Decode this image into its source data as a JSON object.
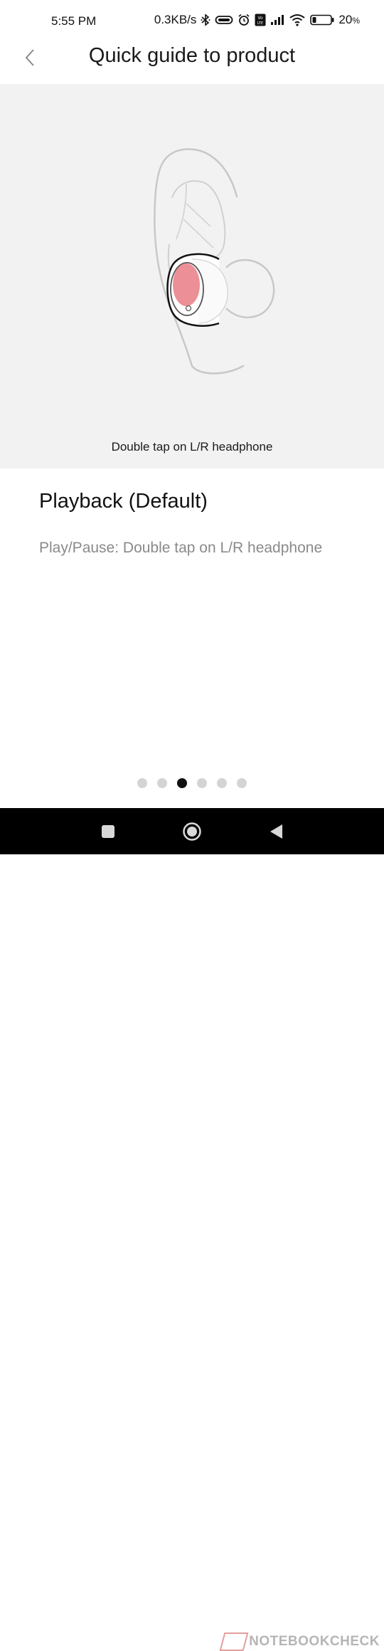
{
  "status_bar": {
    "time": "5:55 PM",
    "net_speed": "0.3KB/s",
    "battery": "20",
    "battery_unit": "%",
    "icons": [
      "bluetooth-icon",
      "headset-icon",
      "alarm-icon",
      "volte-icon",
      "signal-icon",
      "wifi-icon",
      "battery-icon"
    ]
  },
  "header": {
    "title": "Quick guide to product"
  },
  "illustration": {
    "caption": "Double tap on L/R headphone",
    "accent_color": "#ec8f96"
  },
  "content": {
    "title": "Playback (Default)",
    "description": "Play/Pause: Double tap on L/R headphone"
  },
  "pager": {
    "total": 6,
    "active_index": 2
  },
  "nav_bar": {
    "buttons": [
      "square-icon",
      "home-circle-icon",
      "back-triangle-icon"
    ]
  },
  "watermark": {
    "text": "NOTEBOOKCHECK"
  }
}
